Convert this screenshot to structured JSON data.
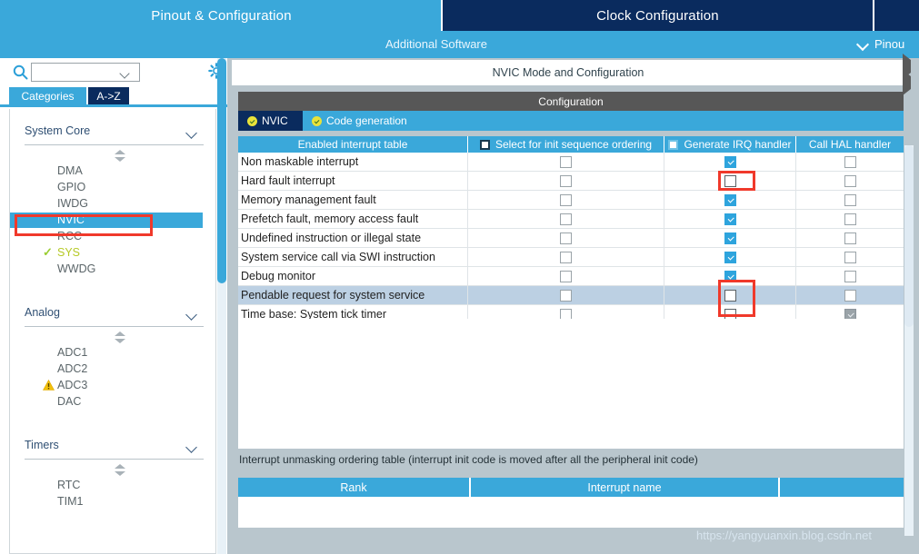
{
  "topbar": {
    "tabs": [
      {
        "label": "Pinout & Configuration",
        "active": false
      },
      {
        "label": "Clock Configuration",
        "active": true
      }
    ]
  },
  "secondbar": {
    "additional_software": "Additional Software",
    "pinout_dropdown": "Pinou",
    "chevron_icon": "chevron-down-icon"
  },
  "sidebar": {
    "search": {
      "value": "",
      "placeholder": "",
      "icon": "search-icon"
    },
    "gear_icon": "gear-icon",
    "subtabs": [
      {
        "label": "Categories",
        "active": false
      },
      {
        "label": "A->Z",
        "active": true
      }
    ],
    "groups": [
      {
        "name": "System Core",
        "chevron_icon": "chevron-down-icon",
        "items": [
          {
            "label": "DMA",
            "state": "none",
            "selected": false
          },
          {
            "label": "GPIO",
            "state": "none",
            "selected": false
          },
          {
            "label": "IWDG",
            "state": "none",
            "selected": false
          },
          {
            "label": "NVIC",
            "state": "none",
            "selected": true
          },
          {
            "label": "RCC",
            "state": "none",
            "selected": false
          },
          {
            "label": "SYS",
            "state": "check",
            "selected": false
          },
          {
            "label": "WWDG",
            "state": "none",
            "selected": false
          }
        ]
      },
      {
        "name": "Analog",
        "chevron_icon": "chevron-down-icon",
        "items": [
          {
            "label": "ADC1",
            "state": "none",
            "selected": false
          },
          {
            "label": "ADC2",
            "state": "none",
            "selected": false
          },
          {
            "label": "ADC3",
            "state": "warn",
            "selected": false
          },
          {
            "label": "DAC",
            "state": "none",
            "selected": false
          }
        ]
      },
      {
        "name": "Timers",
        "chevron_icon": "chevron-down-icon",
        "items": [
          {
            "label": "RTC",
            "state": "none",
            "selected": false
          },
          {
            "label": "TIM1",
            "state": "none",
            "selected": false
          }
        ]
      }
    ]
  },
  "main": {
    "mode_header": "NVIC Mode and Configuration",
    "config_header": "Configuration",
    "tabs": [
      {
        "label": "NVIC",
        "active": true,
        "icon": "check-circle-icon"
      },
      {
        "label": "Code generation",
        "active": false,
        "icon": "check-circle-icon"
      }
    ],
    "table": {
      "headers": [
        {
          "label": "Enabled interrupt table",
          "checkbox": "none"
        },
        {
          "label": "Select for init sequence ordering",
          "checkbox": "unchecked-dark"
        },
        {
          "label": "Generate IRQ handler",
          "checkbox": "unchecked-light"
        },
        {
          "label": "Call HAL handler",
          "checkbox": "none"
        }
      ],
      "rows": [
        {
          "name": "Non maskable interrupt",
          "select_init": "off",
          "generate_irq": "on",
          "call_hal": "off",
          "highlighted": false
        },
        {
          "name": "Hard fault interrupt",
          "select_init": "off",
          "generate_irq": "off-dark",
          "call_hal": "off",
          "highlighted": false
        },
        {
          "name": "Memory management fault",
          "select_init": "off",
          "generate_irq": "on",
          "call_hal": "off",
          "highlighted": false
        },
        {
          "name": "Prefetch fault, memory access fault",
          "select_init": "off",
          "generate_irq": "on",
          "call_hal": "off",
          "highlighted": false
        },
        {
          "name": "Undefined instruction or illegal state",
          "select_init": "off",
          "generate_irq": "on",
          "call_hal": "off",
          "highlighted": false
        },
        {
          "name": "System service call via SWI instruction",
          "select_init": "off",
          "generate_irq": "on",
          "call_hal": "off",
          "highlighted": false
        },
        {
          "name": "Debug monitor",
          "select_init": "off",
          "generate_irq": "on",
          "call_hal": "off",
          "highlighted": false
        },
        {
          "name": "Pendable request for system service",
          "select_init": "off",
          "generate_irq": "off-dark",
          "call_hal": "off",
          "highlighted": true
        },
        {
          "name": "Time base: System tick timer",
          "select_init": "off",
          "generate_irq": "off-dark",
          "call_hal": "disabled-on",
          "highlighted": false
        }
      ]
    },
    "unmasking_label": "Interrupt unmasking ordering table (interrupt init code is moved after all the peripheral init code)",
    "bottom_table": {
      "headers": [
        "Rank",
        "Interrupt name",
        ""
      ],
      "rows": []
    }
  },
  "annotations": {
    "highlight_color": "#f0392b",
    "accent_color": "#3aa8da",
    "dark_color": "#0a2b5e"
  },
  "watermark": "https://yangyuanxin.blog.csdn.net"
}
